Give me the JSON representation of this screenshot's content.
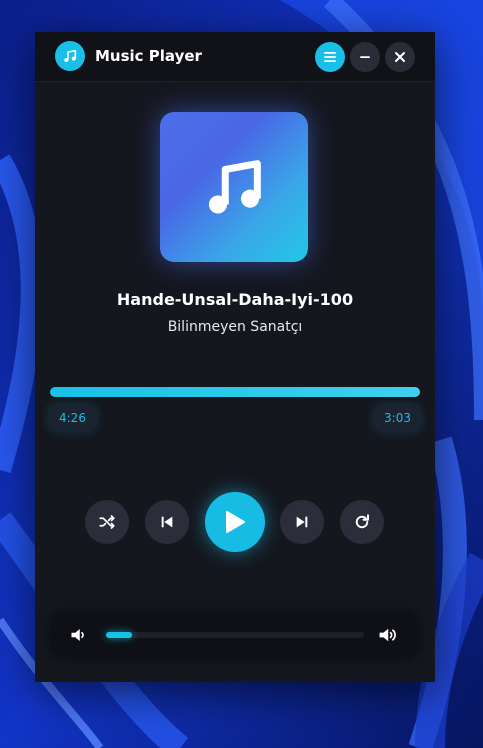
{
  "window": {
    "title": "Music Player"
  },
  "titlebar_buttons": {
    "menu_icon": "menu-icon",
    "minimize_icon": "minimize-icon",
    "close_icon": "close-icon"
  },
  "track": {
    "title": "Hande-Unsal-Daha-Iyi-100",
    "artist": "Bilinmeyen Sanatçı",
    "album_art_icon": "music-note-icon"
  },
  "progress": {
    "elapsed": "4:26",
    "total": "3:03",
    "fraction": 1.0
  },
  "controls": [
    "shuffle-icon",
    "previous-icon",
    "play-icon",
    "next-icon",
    "repeat-icon"
  ],
  "volume": {
    "level": 0.1,
    "min_icon": "volume-low-icon",
    "max_icon": "volume-high-icon"
  },
  "colors": {
    "accent": "#19bfe6",
    "panel": "#15171f",
    "button": "#2b2e3a"
  }
}
